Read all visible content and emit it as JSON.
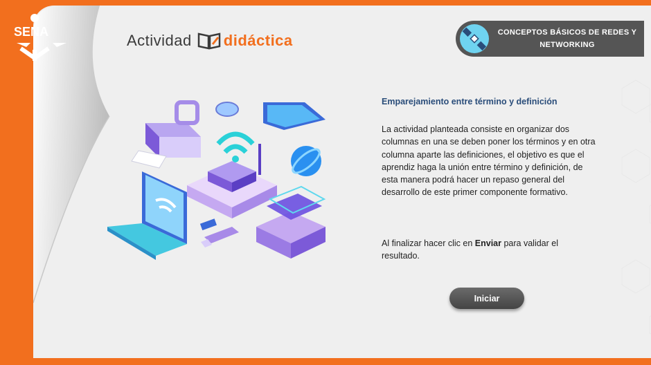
{
  "logo": {
    "text": "SENA",
    "icon": "sena-logo"
  },
  "brand": {
    "word1": "Actividad",
    "word2": "didáctica",
    "icon": "book-pencil-icon",
    "accent_color": "#f26f1e"
  },
  "topic": {
    "label": "CONCEPTOS BÁSICOS DE REDES Y NETWORKING",
    "icon": "satellite-icon"
  },
  "illustration": {
    "icon": "network-devices-illustration"
  },
  "content": {
    "title": "Emparejamiento entre término y definición",
    "description": "La actividad planteada consiste en organizar dos columnas en una se deben poner los términos y en otra columna aparte las definiciones, el objetivo es que el aprendiz haga la unión entre término y definición, de esta manera podrá hacer un repaso general del desarrollo de este primer componente formativo.",
    "instruction_prefix": "Al finalizar hacer clic en ",
    "instruction_bold": "Enviar",
    "instruction_suffix": " para validar el resultado."
  },
  "actions": {
    "start_label": "Iniciar"
  },
  "colors": {
    "background": "#f26f1e",
    "card": "#efefef",
    "title": "#2a4d7a",
    "button": "#555555"
  }
}
